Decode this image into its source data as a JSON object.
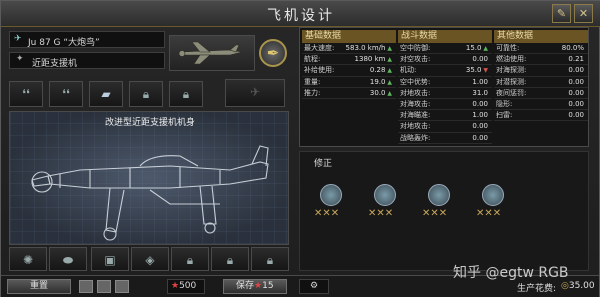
{
  "window": {
    "title": "飞机设计"
  },
  "plane": {
    "name": "Ju 87 G “大炮鸟”",
    "role": "近距支援机"
  },
  "blueprint": {
    "caption": "改进型近距支援机机身"
  },
  "stats": {
    "basic": {
      "header": "基础数据",
      "rows": [
        {
          "label": "最大速度:",
          "value": "583.0 km/h",
          "trend": "up"
        },
        {
          "label": "航程:",
          "value": "1380 km",
          "trend": "up"
        },
        {
          "label": "补给使用:",
          "value": "0.28",
          "trend": "up"
        },
        {
          "label": "重量:",
          "value": "19.0",
          "trend": "up"
        },
        {
          "label": "推力:",
          "value": "30.0",
          "trend": "up"
        }
      ]
    },
    "combat": {
      "header": "战斗数据",
      "rows": [
        {
          "label": "空中防御:",
          "value": "15.0",
          "trend": "up"
        },
        {
          "label": "对空攻击:",
          "value": "0.00",
          "trend": ""
        },
        {
          "label": "机动:",
          "value": "35.0",
          "trend": "down"
        },
        {
          "label": "空中优势:",
          "value": "1.00",
          "trend": ""
        },
        {
          "label": "对地攻击:",
          "value": "31.0",
          "trend": ""
        },
        {
          "label": "对海攻击:",
          "value": "0.00",
          "trend": ""
        },
        {
          "label": "对海瞄准:",
          "value": "1.00",
          "trend": ""
        },
        {
          "label": "对地攻击:",
          "value": "0.00",
          "trend": ""
        },
        {
          "label": "战略轰炸:",
          "value": "0.00",
          "trend": ""
        }
      ]
    },
    "other": {
      "header": "其他数据",
      "rows": [
        {
          "label": "可靠性:",
          "value": "80.0%",
          "trend": ""
        },
        {
          "label": "燃油使用:",
          "value": "0.21",
          "trend": ""
        },
        {
          "label": "对海探测:",
          "value": "0.00",
          "trend": ""
        },
        {
          "label": "对潜探测:",
          "value": "0.00",
          "trend": ""
        },
        {
          "label": "夜间惩罚:",
          "value": "0.00",
          "trend": ""
        },
        {
          "label": "隐形:",
          "value": "0.00",
          "trend": ""
        },
        {
          "label": "扫雷:",
          "value": "0.00",
          "trend": ""
        }
      ]
    }
  },
  "modifiers": {
    "header": "修正"
  },
  "footer": {
    "reset": "重置",
    "cost": "500",
    "save_label": "保存",
    "save_cost": "15",
    "production_label": "生产花费:",
    "production_value": "35.00"
  },
  "watermark": "知乎 @egtw RGB"
}
